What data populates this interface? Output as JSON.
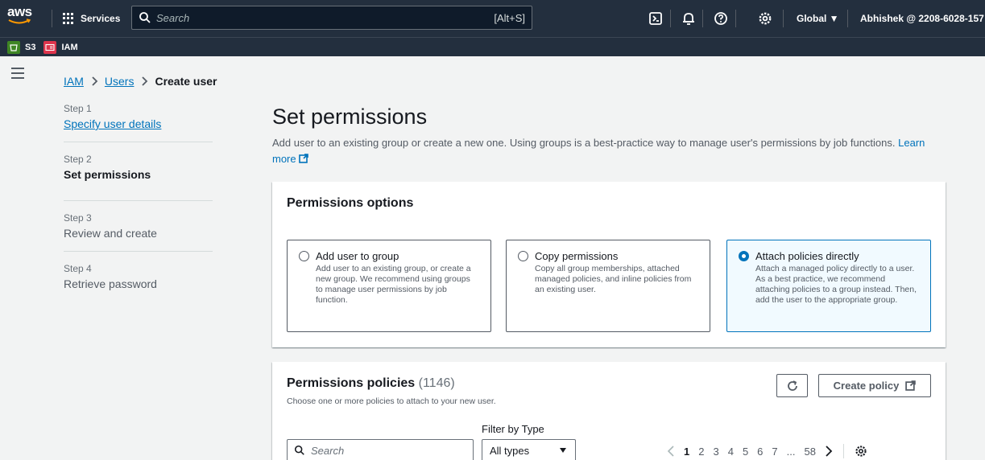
{
  "nav": {
    "logo_text": "aws",
    "services_label": "Services",
    "search_placeholder": "Search",
    "search_shortcut": "[Alt+S]",
    "region_label": "Global ▼",
    "account_label": "Abhishek @ 2208-6028-157"
  },
  "favorites": [
    {
      "label": "S3",
      "color": "#3f8624"
    },
    {
      "label": "IAM",
      "color": "#dd344c"
    }
  ],
  "breadcrumb": {
    "items": [
      "IAM",
      "Users"
    ],
    "current": "Create user"
  },
  "steps": [
    {
      "num": "Step 1",
      "title": "Specify user details"
    },
    {
      "num": "Step 2",
      "title": "Set permissions"
    },
    {
      "num": "Step 3",
      "title": "Review and create"
    },
    {
      "num": "Step 4",
      "title": "Retrieve password"
    }
  ],
  "page": {
    "title": "Set permissions",
    "description": "Add user to an existing group or create a new one. Using groups is a best-practice way to manage user's permissions by job functions.",
    "learn_more": "Learn more"
  },
  "permissions_options": {
    "title": "Permissions options",
    "options": [
      {
        "label": "Add user to group",
        "desc": "Add user to an existing group, or create a new group. We recommend using groups to manage user permissions by job function.",
        "selected": false
      },
      {
        "label": "Copy permissions",
        "desc": "Copy all group memberships, attached managed policies, and inline policies from an existing user.",
        "selected": false
      },
      {
        "label": "Attach policies directly",
        "desc": "Attach a managed policy directly to a user. As a best practice, we recommend attaching policies to a group instead. Then, add the user to the appropriate group.",
        "selected": true
      }
    ]
  },
  "permissions_policies": {
    "title": "Permissions policies",
    "count": "(1146)",
    "subtitle": "Choose one or more policies to attach to your new user.",
    "create_label": "Create policy",
    "filter_label": "Filter by Type",
    "search_placeholder": "Search",
    "type_value": "All types",
    "pages": [
      "1",
      "2",
      "3",
      "4",
      "5",
      "6",
      "7",
      "...",
      "58"
    ]
  },
  "colors": {
    "nav_bg": "#232f3e",
    "link": "#0073bb",
    "selected_bg": "#f1faff"
  }
}
